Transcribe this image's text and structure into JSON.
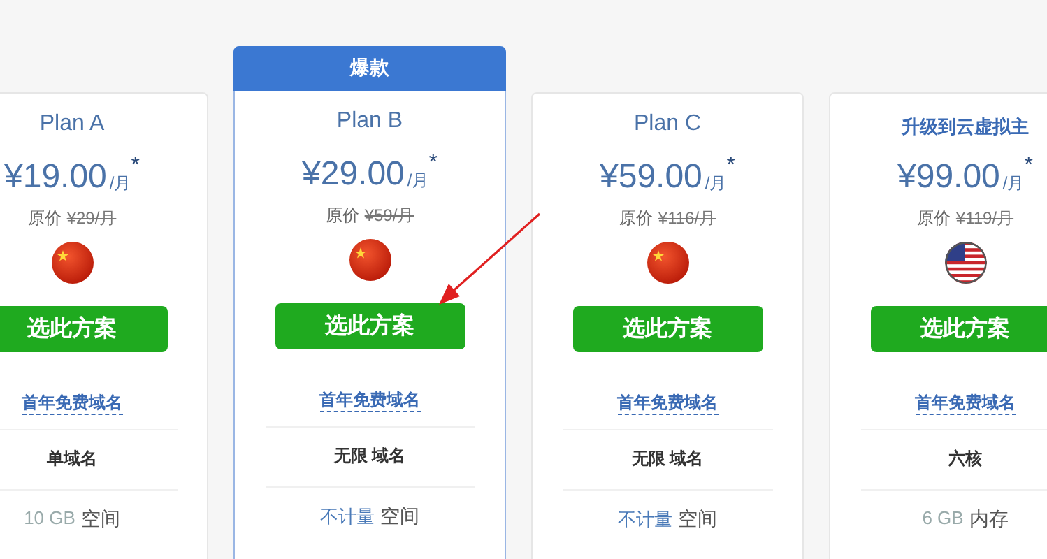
{
  "plans": [
    {
      "kind": "plan",
      "name": "Plan A",
      "price": "¥19.00",
      "per": "/月",
      "star": "*",
      "original_label": "原价",
      "original_price": "¥29/月",
      "flag": {
        "kind": "china"
      },
      "button": "选此方案",
      "link": "首年免费域名",
      "feature": "单域名",
      "spec_value": "10 GB",
      "spec_unit": "空间",
      "highlight": false
    },
    {
      "kind": "plan",
      "name": "Plan B",
      "badge": "爆款",
      "price": "¥29.00",
      "per": "/月",
      "star": "*",
      "original_label": "原价",
      "original_price": "¥59/月",
      "flag": {
        "kind": "china"
      },
      "button": "选此方案",
      "link": "首年免费域名",
      "feature": "无限 域名",
      "spec_value": "不计量",
      "spec_unit": "空间",
      "highlight": true
    },
    {
      "kind": "plan",
      "name": "Plan C",
      "price": "¥59.00",
      "per": "/月",
      "star": "*",
      "original_label": "原价",
      "original_price": "¥116/月",
      "flag": {
        "kind": "china"
      },
      "button": "选此方案",
      "link": "首年免费域名",
      "feature": "无限 域名",
      "spec_value": "不计量",
      "spec_unit": "空间",
      "highlight": true
    },
    {
      "kind": "upgrade",
      "name": "升级到云虚拟主",
      "price": "¥99.00",
      "per": "/月",
      "star": "*",
      "original_label": "原价",
      "original_price": "¥119/月",
      "flag": {
        "kind": "usa"
      },
      "button": "选此方案",
      "link": "首年免费域名",
      "feature": "六核",
      "spec_value": "6 GB",
      "spec_unit": "内存",
      "highlight": false
    }
  ]
}
